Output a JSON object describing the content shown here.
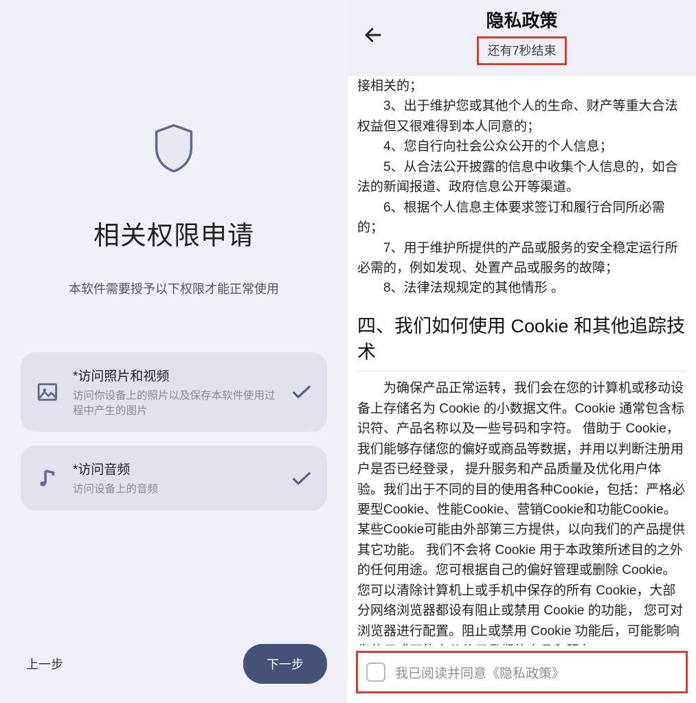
{
  "left": {
    "title": "相关权限申请",
    "subtitle": "本软件需要授予以下权限才能正常使用",
    "permissions": [
      {
        "title": "*访问照片和视频",
        "desc": "访问你设备上的照片以及保存本软件使用过程中产生的图片"
      },
      {
        "title": "*访问音频",
        "desc": "访问设备上的音频"
      }
    ],
    "prev_label": "上一步",
    "next_label": "下一步"
  },
  "right": {
    "header_title": "隐私政策",
    "countdown": "还有7秒结束",
    "body": {
      "frag0": "接相关的；",
      "p3": "3、出于维护您或其他个人的生命、财产等重大合法权益但又很难得到本人同意的；",
      "p4": "4、您自行向社会公众公开的个人信息；",
      "p5": "5、从合法公开披露的信息中收集个人信息的，如合法的新闻报道、政府信息公开等渠道。",
      "p6": "6、根据个人信息主体要求签订和履行合同所必需的；",
      "p7": "7、用于维护所提供的产品或服务的安全稳定运行所必需的，例如发现、处置产品或服务的故障；",
      "p8": "8、法律法规规定的其他情形 。",
      "section4_title": "四、我们如何使用 Cookie 和其他追踪技术",
      "cookie_para": "　　为确保产品正常运转，我们会在您的计算机或移动设备上存储名为 Cookie 的小数据文件。Cookie 通常包含标识符、产品名称以及一些号码和字符。 借助于 Cookie，我们能够存储您的偏好或商品等数据，并用以判断注册用户是否已经登录， 提升服务和产品质量及优化用户体验。我们出于不同的目的使用各种Cookie，包括：严格必要型Cookie、性能Cookie、营销Cookie和功能Cookie。 某些Cookie可能由外部第三方提供，以向我们的产品提供其它功能。 我们不会将 Cookie 用于本政策所述目的之外的任何用途。您可根据自己的偏好管理或删除 Cookie。您可以清除计算机上或手机中保存的所有 Cookie，大部分网络浏览器都设有阻止或禁用 Cookie 的功能， 您可对浏览器进行配置。阻止或禁用 Cookie 功能后，可能影响您使用或不能充分使用我们的产品和服务。"
    },
    "footer_label": "我已阅读并同意《隐私政策》"
  }
}
